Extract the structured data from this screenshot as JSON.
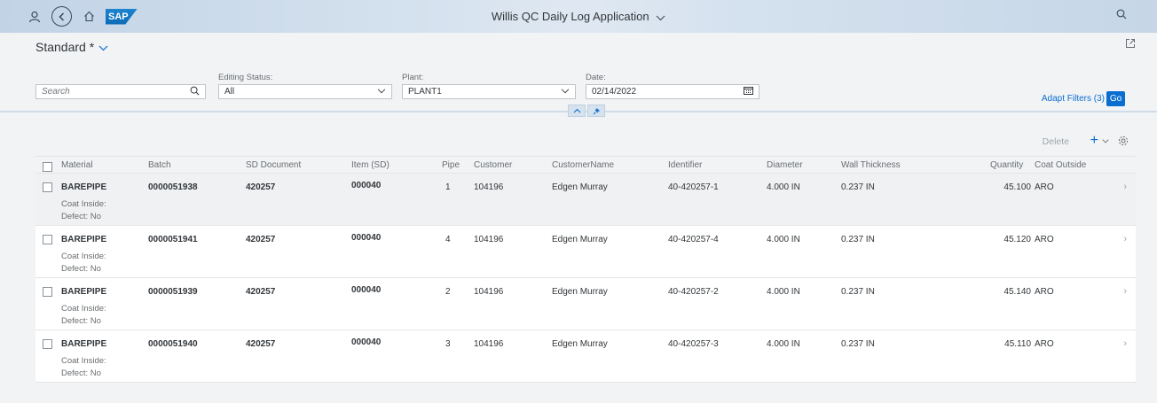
{
  "shell": {
    "title": "Willis QC Daily Log Application",
    "logo": "SAP",
    "icons": [
      "user-icon",
      "back-icon",
      "home-icon",
      "search-icon"
    ]
  },
  "header": {
    "variant": "Standard *",
    "filters": {
      "search_placeholder": "Search",
      "editing_status_label": "Editing Status:",
      "editing_status_value": "All",
      "plant_label": "Plant:",
      "plant_value": "PLANT1",
      "date_label": "Date:",
      "date_value": "02/14/2022"
    },
    "adapt_filters": "Adapt Filters (3)",
    "go": "Go"
  },
  "toolbar": {
    "delete": "Delete"
  },
  "table": {
    "columns": [
      "Material",
      "Batch",
      "SD Document",
      "Item (SD)",
      "Pipe",
      "Customer",
      "CustomerName",
      "Identifier",
      "Diameter",
      "Wall Thickness",
      "Quantity",
      "Coat Outside"
    ],
    "rows": [
      {
        "material": "BAREPIPE",
        "batch": "0000051938",
        "sd": "420257",
        "item": "000040",
        "pipe": "1",
        "customer": "104196",
        "name": "Edgen Murray",
        "identifier": "40-420257-1",
        "diameter": "4.000 IN",
        "wall": "0.237 IN",
        "qty": "45.100",
        "coat": "ARO",
        "coat_inside": "Coat Inside:",
        "defect": "Defect: No"
      },
      {
        "material": "BAREPIPE",
        "batch": "0000051941",
        "sd": "420257",
        "item": "000040",
        "pipe": "4",
        "customer": "104196",
        "name": "Edgen Murray",
        "identifier": "40-420257-4",
        "diameter": "4.000 IN",
        "wall": "0.237 IN",
        "qty": "45.120",
        "coat": "ARO",
        "coat_inside": "Coat Inside:",
        "defect": "Defect: No"
      },
      {
        "material": "BAREPIPE",
        "batch": "0000051939",
        "sd": "420257",
        "item": "000040",
        "pipe": "2",
        "customer": "104196",
        "name": "Edgen Murray",
        "identifier": "40-420257-2",
        "diameter": "4.000 IN",
        "wall": "0.237 IN",
        "qty": "45.140",
        "coat": "ARO",
        "coat_inside": "Coat Inside:",
        "defect": "Defect: No"
      },
      {
        "material": "BAREPIPE",
        "batch": "0000051940",
        "sd": "420257",
        "item": "000040",
        "pipe": "3",
        "customer": "104196",
        "name": "Edgen Murray",
        "identifier": "40-420257-3",
        "diameter": "4.000 IN",
        "wall": "0.237 IN",
        "qty": "45.110",
        "coat": "ARO",
        "coat_inside": "Coat Inside:",
        "defect": "Defect: No"
      }
    ]
  },
  "colors": {
    "accent": "#0a6ed1",
    "shell": "#d4e1ee",
    "background": "#f1f3f5"
  }
}
